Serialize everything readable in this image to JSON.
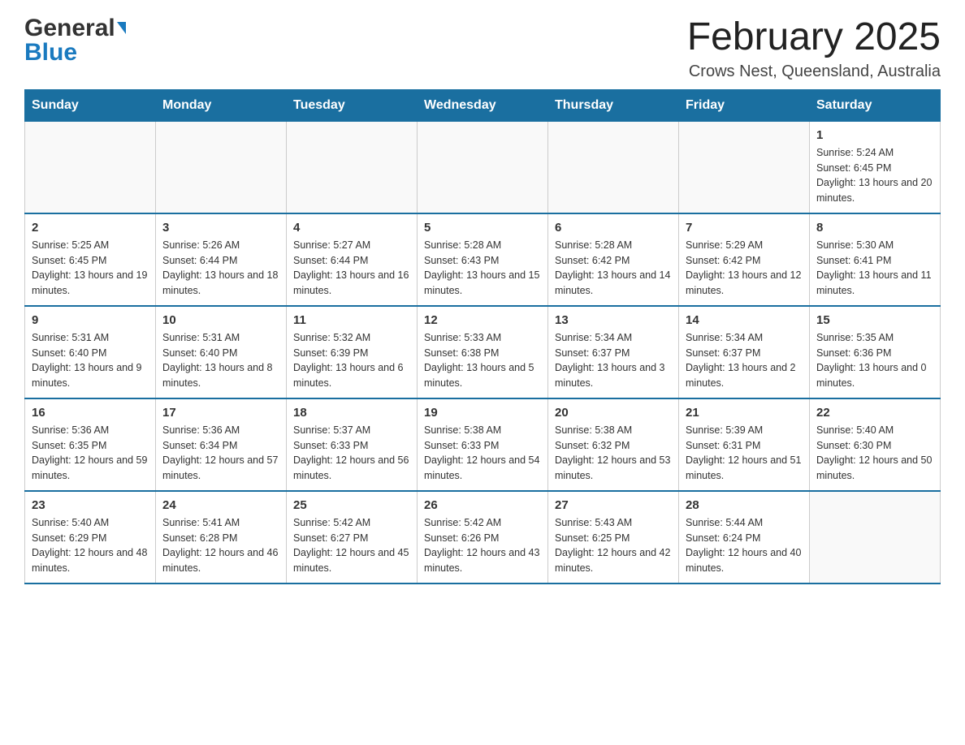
{
  "header": {
    "logo": {
      "general": "General",
      "blue": "Blue",
      "arrow_char": "▼"
    },
    "title": "February 2025",
    "subtitle": "Crows Nest, Queensland, Australia"
  },
  "calendar": {
    "days_of_week": [
      "Sunday",
      "Monday",
      "Tuesday",
      "Wednesday",
      "Thursday",
      "Friday",
      "Saturday"
    ],
    "weeks": [
      {
        "cells": [
          {
            "day": "",
            "empty": true
          },
          {
            "day": "",
            "empty": true
          },
          {
            "day": "",
            "empty": true
          },
          {
            "day": "",
            "empty": true
          },
          {
            "day": "",
            "empty": true
          },
          {
            "day": "",
            "empty": true
          },
          {
            "day": "1",
            "sunrise": "Sunrise: 5:24 AM",
            "sunset": "Sunset: 6:45 PM",
            "daylight": "Daylight: 13 hours and 20 minutes."
          }
        ]
      },
      {
        "cells": [
          {
            "day": "2",
            "sunrise": "Sunrise: 5:25 AM",
            "sunset": "Sunset: 6:45 PM",
            "daylight": "Daylight: 13 hours and 19 minutes."
          },
          {
            "day": "3",
            "sunrise": "Sunrise: 5:26 AM",
            "sunset": "Sunset: 6:44 PM",
            "daylight": "Daylight: 13 hours and 18 minutes."
          },
          {
            "day": "4",
            "sunrise": "Sunrise: 5:27 AM",
            "sunset": "Sunset: 6:44 PM",
            "daylight": "Daylight: 13 hours and 16 minutes."
          },
          {
            "day": "5",
            "sunrise": "Sunrise: 5:28 AM",
            "sunset": "Sunset: 6:43 PM",
            "daylight": "Daylight: 13 hours and 15 minutes."
          },
          {
            "day": "6",
            "sunrise": "Sunrise: 5:28 AM",
            "sunset": "Sunset: 6:42 PM",
            "daylight": "Daylight: 13 hours and 14 minutes."
          },
          {
            "day": "7",
            "sunrise": "Sunrise: 5:29 AM",
            "sunset": "Sunset: 6:42 PM",
            "daylight": "Daylight: 13 hours and 12 minutes."
          },
          {
            "day": "8",
            "sunrise": "Sunrise: 5:30 AM",
            "sunset": "Sunset: 6:41 PM",
            "daylight": "Daylight: 13 hours and 11 minutes."
          }
        ]
      },
      {
        "cells": [
          {
            "day": "9",
            "sunrise": "Sunrise: 5:31 AM",
            "sunset": "Sunset: 6:40 PM",
            "daylight": "Daylight: 13 hours and 9 minutes."
          },
          {
            "day": "10",
            "sunrise": "Sunrise: 5:31 AM",
            "sunset": "Sunset: 6:40 PM",
            "daylight": "Daylight: 13 hours and 8 minutes."
          },
          {
            "day": "11",
            "sunrise": "Sunrise: 5:32 AM",
            "sunset": "Sunset: 6:39 PM",
            "daylight": "Daylight: 13 hours and 6 minutes."
          },
          {
            "day": "12",
            "sunrise": "Sunrise: 5:33 AM",
            "sunset": "Sunset: 6:38 PM",
            "daylight": "Daylight: 13 hours and 5 minutes."
          },
          {
            "day": "13",
            "sunrise": "Sunrise: 5:34 AM",
            "sunset": "Sunset: 6:37 PM",
            "daylight": "Daylight: 13 hours and 3 minutes."
          },
          {
            "day": "14",
            "sunrise": "Sunrise: 5:34 AM",
            "sunset": "Sunset: 6:37 PM",
            "daylight": "Daylight: 13 hours and 2 minutes."
          },
          {
            "day": "15",
            "sunrise": "Sunrise: 5:35 AM",
            "sunset": "Sunset: 6:36 PM",
            "daylight": "Daylight: 13 hours and 0 minutes."
          }
        ]
      },
      {
        "cells": [
          {
            "day": "16",
            "sunrise": "Sunrise: 5:36 AM",
            "sunset": "Sunset: 6:35 PM",
            "daylight": "Daylight: 12 hours and 59 minutes."
          },
          {
            "day": "17",
            "sunrise": "Sunrise: 5:36 AM",
            "sunset": "Sunset: 6:34 PM",
            "daylight": "Daylight: 12 hours and 57 minutes."
          },
          {
            "day": "18",
            "sunrise": "Sunrise: 5:37 AM",
            "sunset": "Sunset: 6:33 PM",
            "daylight": "Daylight: 12 hours and 56 minutes."
          },
          {
            "day": "19",
            "sunrise": "Sunrise: 5:38 AM",
            "sunset": "Sunset: 6:33 PM",
            "daylight": "Daylight: 12 hours and 54 minutes."
          },
          {
            "day": "20",
            "sunrise": "Sunrise: 5:38 AM",
            "sunset": "Sunset: 6:32 PM",
            "daylight": "Daylight: 12 hours and 53 minutes."
          },
          {
            "day": "21",
            "sunrise": "Sunrise: 5:39 AM",
            "sunset": "Sunset: 6:31 PM",
            "daylight": "Daylight: 12 hours and 51 minutes."
          },
          {
            "day": "22",
            "sunrise": "Sunrise: 5:40 AM",
            "sunset": "Sunset: 6:30 PM",
            "daylight": "Daylight: 12 hours and 50 minutes."
          }
        ]
      },
      {
        "cells": [
          {
            "day": "23",
            "sunrise": "Sunrise: 5:40 AM",
            "sunset": "Sunset: 6:29 PM",
            "daylight": "Daylight: 12 hours and 48 minutes."
          },
          {
            "day": "24",
            "sunrise": "Sunrise: 5:41 AM",
            "sunset": "Sunset: 6:28 PM",
            "daylight": "Daylight: 12 hours and 46 minutes."
          },
          {
            "day": "25",
            "sunrise": "Sunrise: 5:42 AM",
            "sunset": "Sunset: 6:27 PM",
            "daylight": "Daylight: 12 hours and 45 minutes."
          },
          {
            "day": "26",
            "sunrise": "Sunrise: 5:42 AM",
            "sunset": "Sunset: 6:26 PM",
            "daylight": "Daylight: 12 hours and 43 minutes."
          },
          {
            "day": "27",
            "sunrise": "Sunrise: 5:43 AM",
            "sunset": "Sunset: 6:25 PM",
            "daylight": "Daylight: 12 hours and 42 minutes."
          },
          {
            "day": "28",
            "sunrise": "Sunrise: 5:44 AM",
            "sunset": "Sunset: 6:24 PM",
            "daylight": "Daylight: 12 hours and 40 minutes."
          },
          {
            "day": "",
            "empty": true
          }
        ]
      }
    ]
  }
}
